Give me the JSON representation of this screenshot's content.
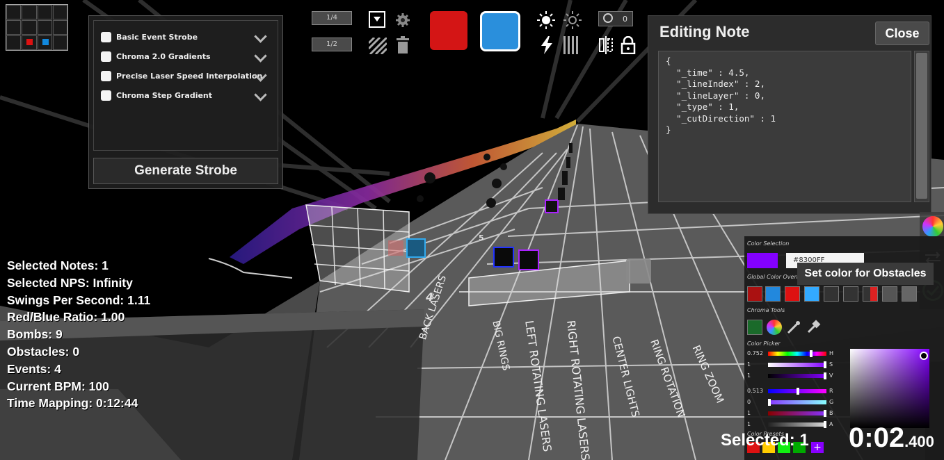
{
  "strobe_panel": {
    "options": [
      {
        "label": "Basic Event Strobe"
      },
      {
        "label": "Chroma 2.0 Gradients"
      },
      {
        "label": "Precise Laser Speed Interpolation"
      },
      {
        "label": "Chroma Step Gradient"
      }
    ],
    "generate_label": "Generate Strobe"
  },
  "toolbar": {
    "precision_top": "1/4",
    "precision_bottom": "1/2",
    "speed_value": "0",
    "left_color": "#d41515",
    "right_color": "#2a8fdc"
  },
  "editing_note": {
    "title": "Editing Note",
    "close_label": "Close",
    "json_text": "{\n  \"_time\" : 4.5,\n  \"_lineIndex\" : 2,\n  \"_lineLayer\" : 0,\n  \"_type\" : 1,\n  \"_cutDirection\" : 1\n}"
  },
  "stats": [
    {
      "label": "Selected Notes: 1"
    },
    {
      "label": "Selected NPS: Infinity"
    },
    {
      "label": "Swings Per Second: 1.11"
    },
    {
      "label": "Red/Blue Ratio: 1.00"
    },
    {
      "label": "Bombs: 9"
    },
    {
      "label": "Obstacles: 0"
    },
    {
      "label": "Events: 4"
    },
    {
      "label": "Current BPM: 100"
    },
    {
      "label": "Time Mapping: 0:12:44"
    }
  ],
  "lane_labels": [
    "BACK LASERS",
    "BIG RINGS",
    "LEFT ROTATING LASERS",
    "RIGHT ROTATING LASERS",
    "CENTER LIGHTS",
    "RING ROTATION",
    "RING ZOOM"
  ],
  "lane_numbers": [
    "4",
    "5"
  ],
  "color_panel": {
    "color_selection_label": "Color Selection",
    "hex_value": "#8300FF",
    "tooltip": "Set color for Obstacles",
    "global_overrides_label": "Global Color Overrides",
    "chroma_tools_label": "Chroma Tools",
    "color_picker_label": "Color Picker",
    "color_presets_label": "Color Presets",
    "sliders_hsv": [
      {
        "value": "0.752",
        "letter": "H",
        "knob": 0.752
      },
      {
        "value": "1",
        "letter": "S",
        "knob": 1
      },
      {
        "value": "1",
        "letter": "V",
        "knob": 1
      }
    ],
    "sliders_rgba": [
      {
        "value": "0.513",
        "letter": "R",
        "knob": 0.513
      },
      {
        "value": "0",
        "letter": "G",
        "knob": 0
      },
      {
        "value": "1",
        "letter": "B",
        "knob": 1
      },
      {
        "value": "1",
        "letter": "A",
        "knob": 1
      }
    ]
  },
  "selected_label": "Selected: 1",
  "timer": {
    "main": "0:02",
    "fraction": ".400"
  }
}
